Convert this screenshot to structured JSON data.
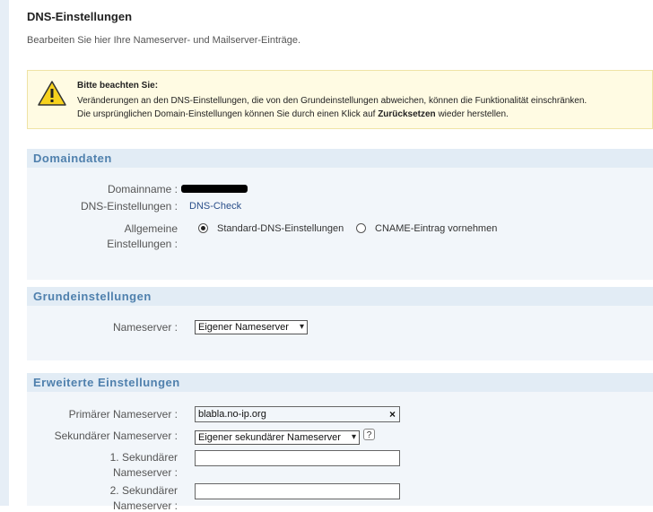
{
  "page": {
    "title": "DNS-Einstellungen",
    "subtitle": "Bearbeiten Sie hier Ihre Nameserver- und Mailserver-Einträge."
  },
  "notice": {
    "icon": "warning-icon",
    "title": "Bitte beachten Sie:",
    "line1": "Veränderungen an den DNS-Einstellungen, die von den Grundeinstellungen abweichen, können die Funktionalität einschränken.",
    "line2_before": "Die ursprünglichen Domain-Einstellungen können Sie durch einen Klick auf",
    "line2_bold": "Zurücksetzen",
    "line2_after": "wieder herstellen."
  },
  "domaindaten": {
    "heading": "Domaindaten",
    "domainname_label": "Domainname :",
    "dns_label": "DNS-Einstellungen :",
    "dns_link": "DNS-Check",
    "allgemeine_label_1": "Allgemeine",
    "allgemeine_label_2": "Einstellungen :",
    "option_standard": "Standard-DNS-Einstellungen",
    "option_cname": "CNAME-Eintrag vornehmen",
    "selected_option": "standard"
  },
  "grundeinstellungen": {
    "heading": "Grundeinstellungen",
    "nameserver_label": "Nameserver :",
    "nameserver_value": "Eigener Nameserver"
  },
  "erweitert": {
    "heading": "Erweiterte Einstellungen",
    "primary_label": "Primärer Nameserver :",
    "primary_value": "blabla.no-ip.org",
    "secondary_label": "Sekundärer Nameserver :",
    "secondary_value": "Eigener sekundärer Nameserver",
    "help_glyph": "?",
    "sec1_label_1": "1. Sekundärer",
    "sec1_label_2": "Nameserver :",
    "sec1_value": "",
    "sec2_label_1": "2. Sekundärer",
    "sec2_label_2": "Nameserver :",
    "sec2_value": ""
  }
}
